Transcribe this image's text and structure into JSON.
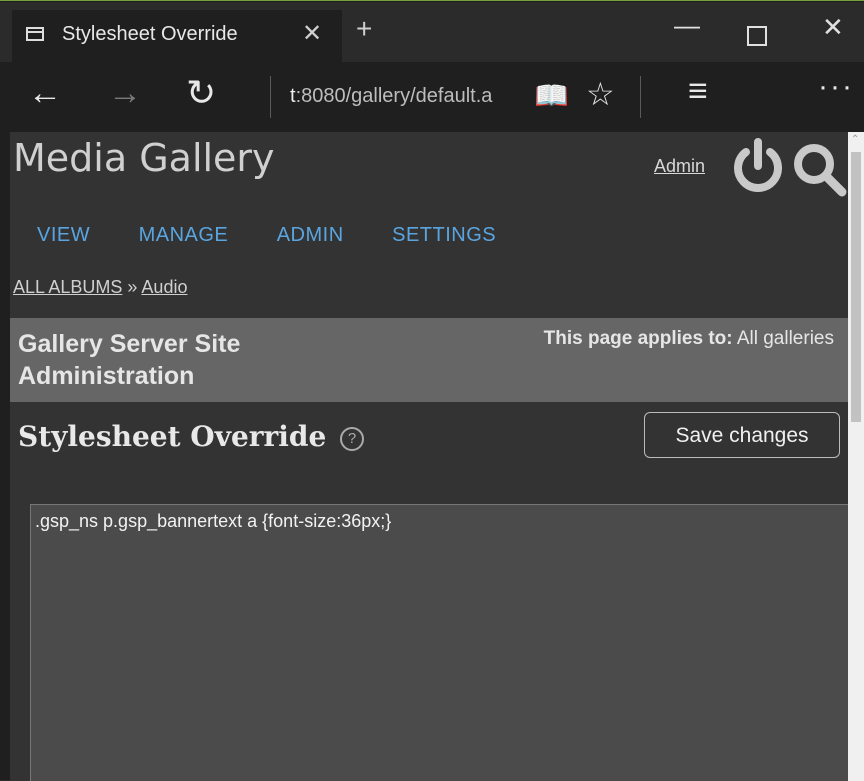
{
  "browser": {
    "tab_title": "Stylesheet Override",
    "tab_close": "✕",
    "new_tab": "+",
    "url_prefix": "t",
    "url_rest": ":8080/gallery/default.a",
    "window_minimize": "—",
    "window_close": "✕",
    "toolbar": {
      "back": "←",
      "forward": "→",
      "refresh": "↻",
      "reading_view": "📖",
      "favorite": "☆",
      "hub": "≡",
      "more": "···"
    }
  },
  "gallery": {
    "site_title": "Media Gallery",
    "user_link": "Admin",
    "menu": [
      "VIEW",
      "MANAGE",
      "ADMIN",
      "SETTINGS"
    ],
    "breadcrumb": {
      "root": "ALL ALBUMS",
      "separator": " » ",
      "current": "Audio"
    },
    "admin_title": "Gallery Server Site Administration",
    "applies_label": "This page applies to:",
    "applies_value": " All galleries",
    "section_title": "Stylesheet Override",
    "help_icon": "?",
    "save_button": "Save changes",
    "css_content": ".gsp_ns p.gsp_bannertext a {font-size:36px;}"
  },
  "colors": {
    "menu_link": "#5aa5e0",
    "banner_bg": "#666666",
    "page_bg": "#333333"
  }
}
